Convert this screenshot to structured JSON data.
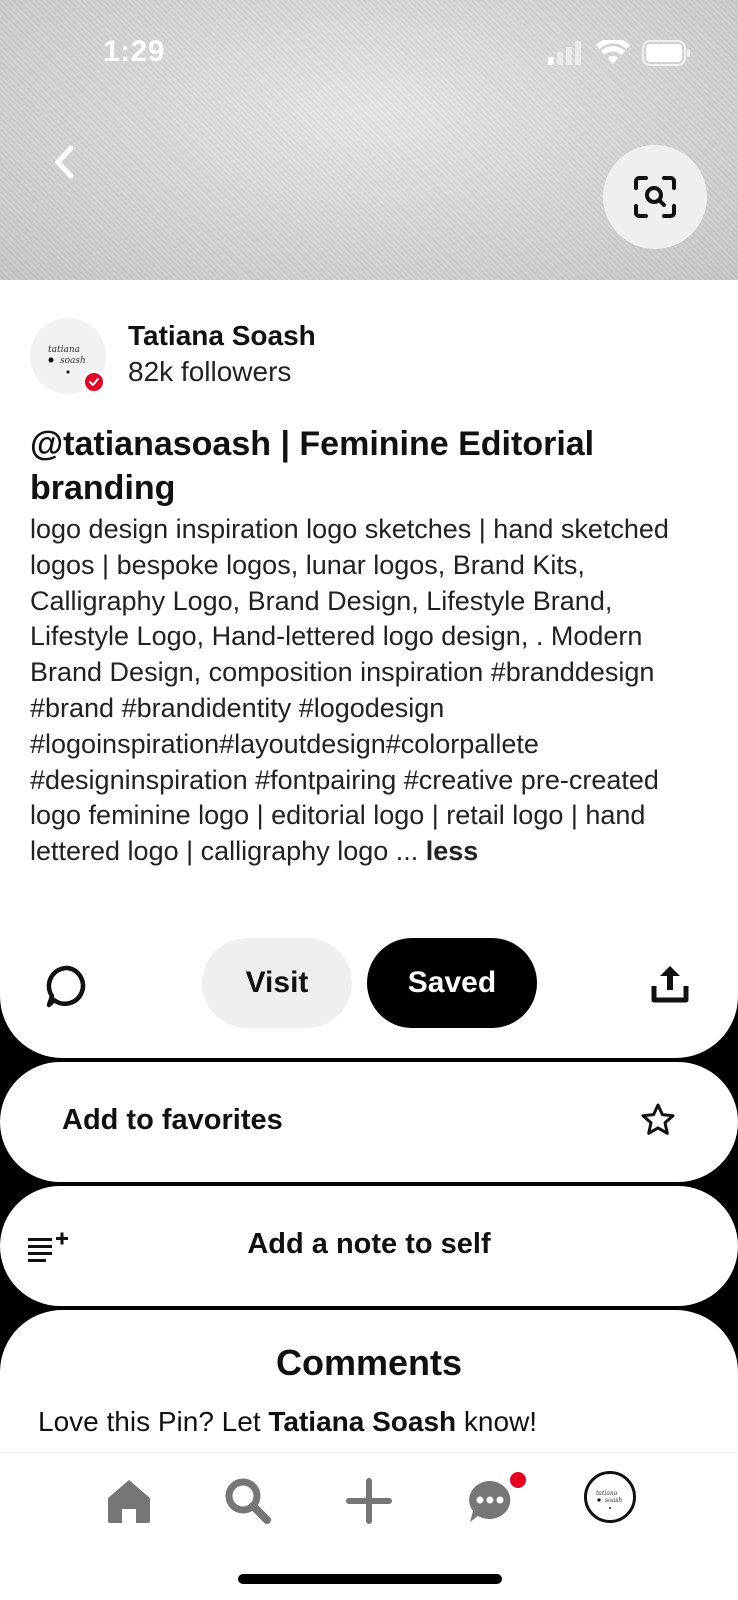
{
  "status_bar": {
    "time": "1:29"
  },
  "creator": {
    "name": "Tatiana Soash",
    "followers": "82k followers",
    "avatar_logo_text": "tatiana soash"
  },
  "pin": {
    "title": "@tatianasoash | Feminine Editorial branding",
    "description": "logo design inspiration logo sketches | hand sketched logos | bespoke logos, lunar logos, Brand Kits, Calligraphy Logo, Brand Design, Lifestyle Brand, Lifestyle Logo, Hand-lettered logo design, . Modern Brand Design, composition inspiration #branddesign #brand #brandidentity #logodesign #logoinspiration#layoutdesign#colorpallete #designinspiration #fontpairing #creative pre-created logo feminine logo | editorial logo | retail logo | hand lettered logo | calligraphy logo ...",
    "less_label": "less"
  },
  "actions": {
    "visit_label": "Visit",
    "saved_label": "Saved"
  },
  "favorites": {
    "label": "Add to favorites"
  },
  "note": {
    "label": "Add a note to self"
  },
  "comments": {
    "title": "Comments",
    "prompt_prefix": "Love this Pin? Let ",
    "prompt_name": "Tatiana Soash",
    "prompt_suffix": " know!"
  },
  "nav": {
    "items": [
      "home-icon",
      "search-icon",
      "plus-icon",
      "messages-icon",
      "profile-avatar"
    ],
    "notification_dot": true
  },
  "colors": {
    "accent": "#e60023",
    "saved_bg": "#000000",
    "visit_bg": "#efefef"
  }
}
